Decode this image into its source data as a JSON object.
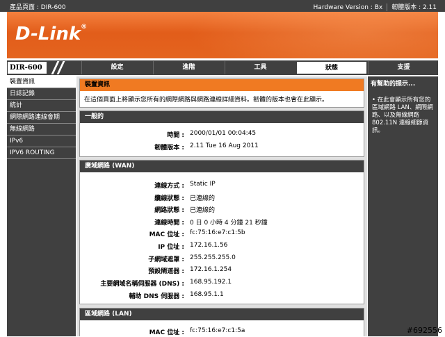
{
  "topbar": {
    "product_label": "產品頁面 : DIR-600",
    "hardware": "Hardware Version : Bx",
    "firmware": "韌體版本 : 2.11"
  },
  "brand": {
    "logo": "D-Link",
    "reg": "®"
  },
  "nav": {
    "model": "DIR-600",
    "tabs": [
      "設定",
      "進階",
      "工具",
      "狀態",
      "支援"
    ],
    "active_tab": "狀態"
  },
  "sidebar": {
    "items": [
      "裝置資訊",
      "日誌記錄",
      "統計",
      "網際網路連線會期",
      "無線網路",
      "IPv6",
      "IPV6 ROUTING"
    ],
    "active": "裝置資訊"
  },
  "hint": {
    "title": "有幫助的提示...",
    "body": "•  在此會顯示所有您的區域網路 LAN、網際網路、以及無線網路 802.11N 連線細節資訊。"
  },
  "device_info": {
    "title": "裝置資訊",
    "intro": "在這個頁面上將顯示您所有的網際網路與網路連線詳細資料。韌體的版本也會在此顯示。"
  },
  "general": {
    "title": "一般的",
    "rows": [
      {
        "label": "時間 :",
        "value": "2000/01/01 00:04:45"
      },
      {
        "label": "韌體版本 :",
        "value": "2.11 Tue 16 Aug 2011"
      }
    ]
  },
  "wan": {
    "title": "廣域網路 (WAN)",
    "rows": [
      {
        "label": "連線方式 :",
        "value": "Static IP"
      },
      {
        "label": "纜線狀態 :",
        "value": "已連線的"
      },
      {
        "label": "網路狀態 :",
        "value": "已連線的"
      },
      {
        "label": "連線時間 :",
        "value": "0 日 0 小時 4 分鐘 21 秒鐘"
      },
      {
        "label": "MAC 位址 :",
        "value": "fc:75:16:e7:c1:5b"
      },
      {
        "label": "IP 位址 :",
        "value": "172.16.1.56"
      },
      {
        "label": "子網域遮罩 :",
        "value": "255.255.255.0"
      },
      {
        "label": "預設閘道器 :",
        "value": "172.16.1.254"
      },
      {
        "label": "主要網域名稱伺服器 (DNS) :",
        "value": "168.95.192.1"
      },
      {
        "label": "輔助 DNS 伺服器 :",
        "value": "168.95.1.1"
      }
    ]
  },
  "lan": {
    "title": "區域網路 (LAN)",
    "rows": [
      {
        "label": "MAC 位址 :",
        "value": "fc:75:16:e7:c1:5a"
      }
    ]
  },
  "watermark": "#692556"
}
